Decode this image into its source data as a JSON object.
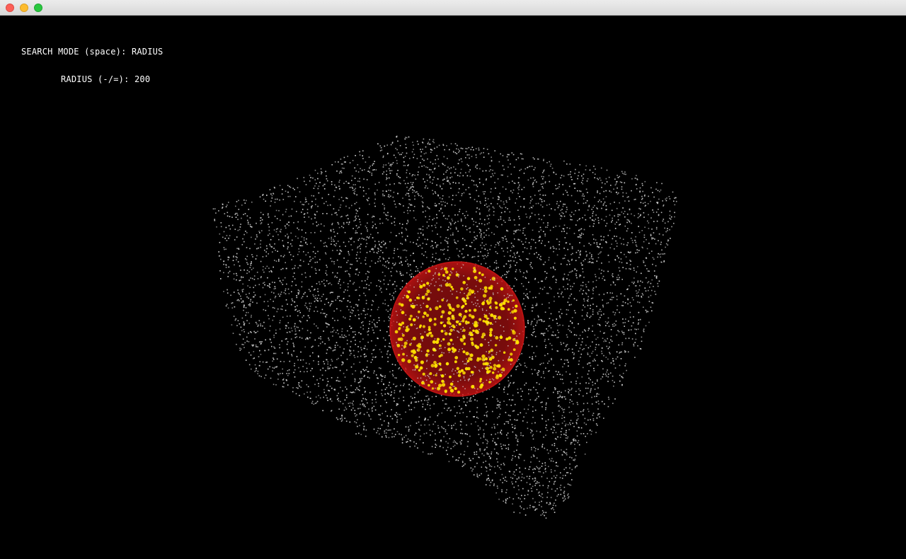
{
  "window": {
    "controls": [
      "close",
      "minimize",
      "zoom"
    ]
  },
  "hud": {
    "search_mode_label": "SEARCH MODE (space):",
    "search_mode_value": "RADIUS",
    "radius_label": "RADIUS (-/=):",
    "radius_value": "200"
  },
  "scene": {
    "background": "#000000",
    "point_color": "#d9d9d9",
    "hit_point_color": "#ffe100",
    "sphere_color": "#c81414"
  }
}
